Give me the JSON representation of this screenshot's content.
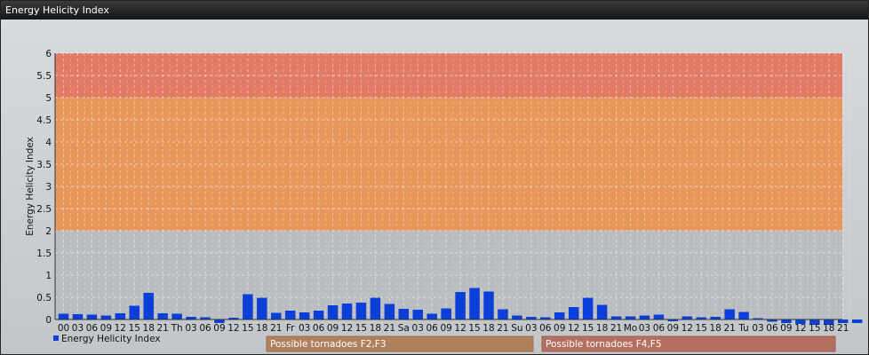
{
  "window": {
    "title": "Energy Helicity Index"
  },
  "chart_data": {
    "type": "bar",
    "ylabel": "Energy Helicity Index",
    "ylim": [
      0,
      6
    ],
    "yticks": [
      "0",
      "0.5",
      "1",
      "1.5",
      "2",
      "2.5",
      "3",
      "3.5",
      "4",
      "4.5",
      "5",
      "5.5",
      "6"
    ],
    "grid": true,
    "categories": [
      "00",
      "03",
      "06",
      "09",
      "12",
      "15",
      "18",
      "21",
      "Th",
      "03",
      "06",
      "09",
      "12",
      "15",
      "18",
      "21",
      "Fr",
      "03",
      "06",
      "09",
      "12",
      "15",
      "18",
      "21",
      "Sa",
      "03",
      "06",
      "09",
      "12",
      "15",
      "18",
      "21",
      "Su",
      "03",
      "06",
      "09",
      "12",
      "15",
      "18",
      "21",
      "Mo",
      "03",
      "06",
      "09",
      "12",
      "15",
      "18",
      "21",
      "Tu",
      "03",
      "06",
      "09",
      "12",
      "15",
      "18",
      "21"
    ],
    "series": [
      {
        "name": "Energy Helicity Index",
        "color": "#0a3fd8",
        "values": [
          0.13,
          0.12,
          0.11,
          0.09,
          0.14,
          0.31,
          0.6,
          0.14,
          0.13,
          0.06,
          0.05,
          -0.08,
          0.04,
          0.57,
          0.49,
          0.15,
          0.2,
          0.16,
          0.2,
          0.32,
          0.36,
          0.38,
          0.49,
          0.35,
          0.24,
          0.22,
          0.13,
          0.25,
          0.62,
          0.71,
          0.63,
          0.23,
          0.09,
          0.06,
          0.05,
          0.16,
          0.28,
          0.49,
          0.33,
          0.07,
          0.07,
          0.09,
          0.11,
          -0.04,
          0.07,
          0.05,
          0.06,
          0.23,
          0.17,
          0.03,
          -0.05,
          -0.08,
          -0.1,
          -0.12,
          -0.12,
          -0.08,
          -0.08
        ]
      }
    ],
    "zones": [
      {
        "from": 2,
        "to": 5,
        "label": "Possible tornadoes F2,F3",
        "color": "#e8975c"
      },
      {
        "from": 5,
        "to": 6,
        "label": "Possible tornadoes F4,F5",
        "color": "#e27b66"
      }
    ],
    "legend": "bottom-left"
  }
}
